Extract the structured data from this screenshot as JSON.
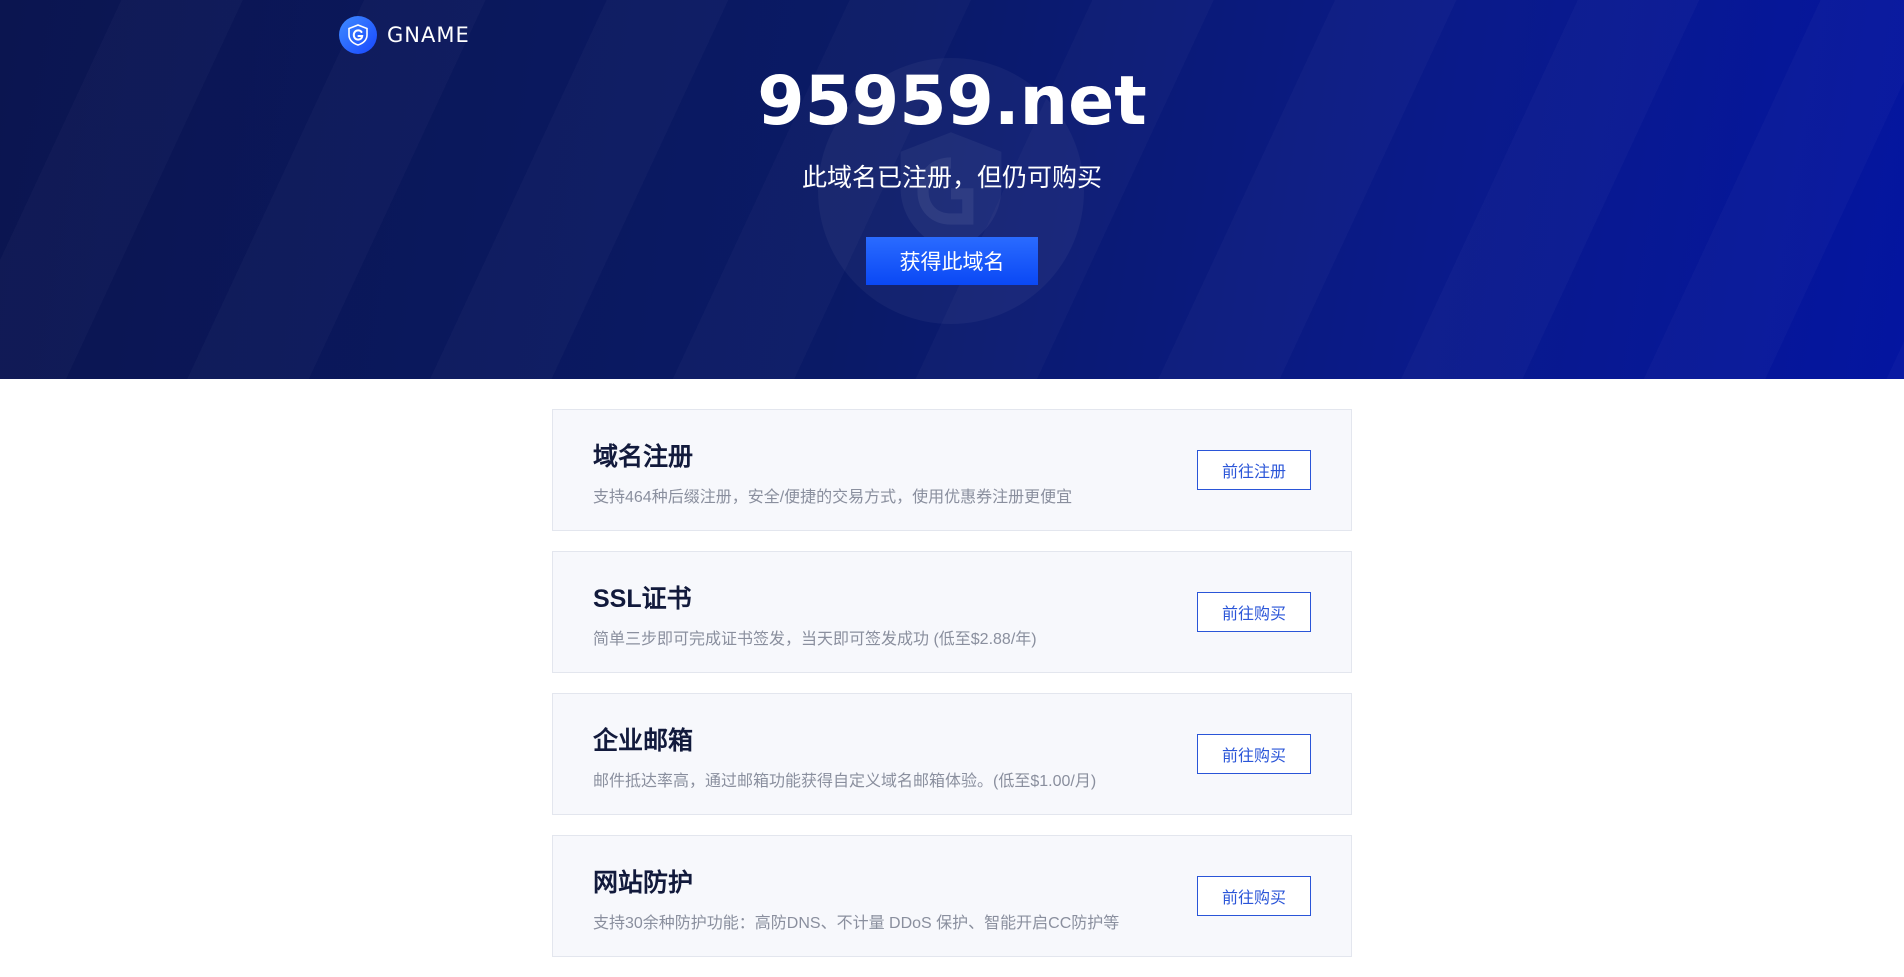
{
  "brand": {
    "logo_text": "GNAME"
  },
  "hero": {
    "domain": "95959.net",
    "subtitle": "此域名已注册，但仍可购买",
    "cta_label": "获得此域名"
  },
  "services": [
    {
      "title": "域名注册",
      "description": "支持464种后缀注册，安全/便捷的交易方式，使用优惠券注册更便宜",
      "button_label": "前往注册"
    },
    {
      "title": "SSL证书",
      "description": "简单三步即可完成证书签发，当天即可签发成功 (低至$2.88/年)",
      "button_label": "前往购买"
    },
    {
      "title": "企业邮箱",
      "description": "邮件抵达率高，通过邮箱功能获得自定义域名邮箱体验。(低至$1.00/月)",
      "button_label": "前往购买"
    },
    {
      "title": "网站防护",
      "description": "支持30余种防护功能：高防DNS、不计量 DDoS 保护、智能开启CC防护等",
      "button_label": "前往购买"
    }
  ],
  "colors": {
    "hero_bg": "#0a1a66",
    "cta_blue": "#0a48f5",
    "card_bg": "#f7f8fc",
    "link_blue": "#2a55d8"
  }
}
